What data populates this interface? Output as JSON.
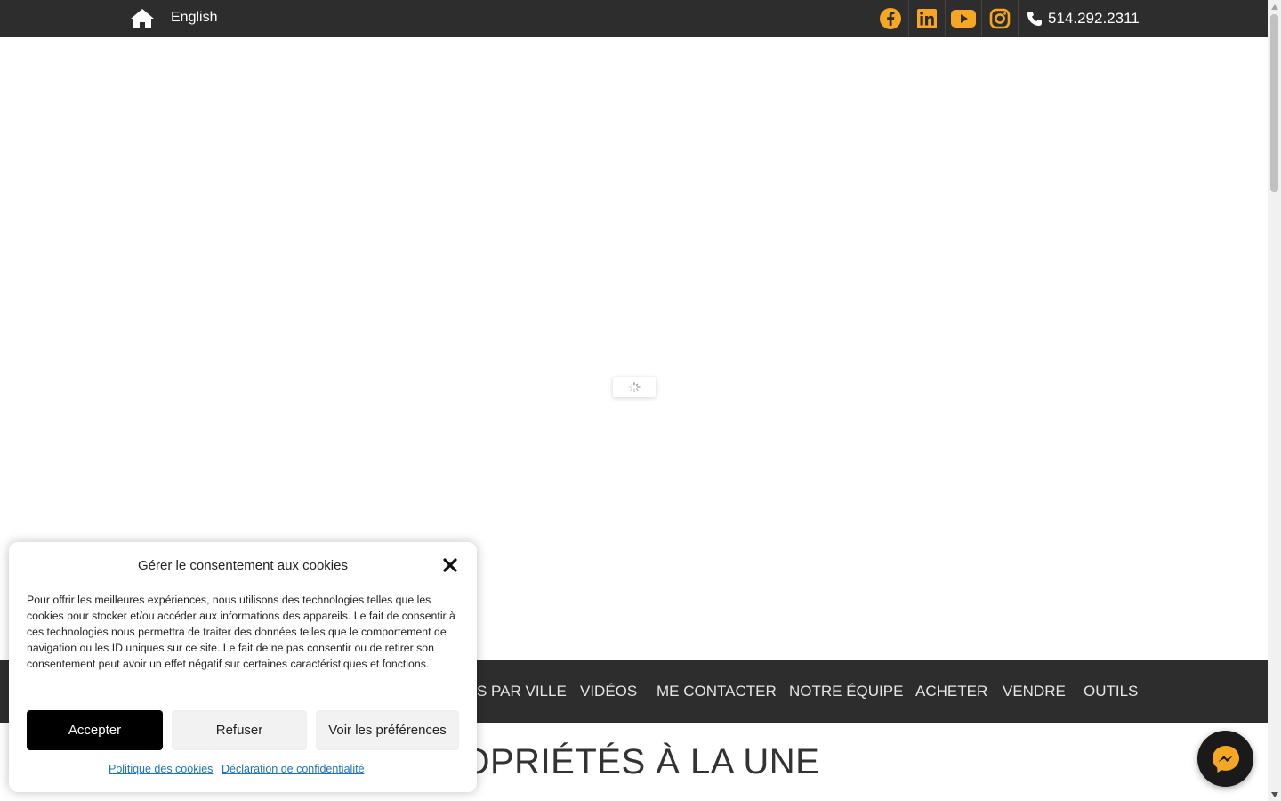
{
  "topbar": {
    "home_icon": "home-icon",
    "lang_label": "English",
    "social": [
      {
        "name": "facebook",
        "icon": "facebook-icon"
      },
      {
        "name": "linkedin",
        "icon": "linkedin-icon"
      },
      {
        "name": "youtube",
        "icon": "youtube-icon"
      },
      {
        "name": "instagram",
        "icon": "instagram-icon"
      }
    ],
    "phone_icon": "phone-icon",
    "phone": "514.292.2311",
    "icon_color": "#f5a623",
    "bg_color": "#2d2d2d"
  },
  "hero": {
    "loading_icon": "spinner-icon"
  },
  "nav": {
    "items": [
      "S PAR VILLE",
      "VIDÉOS",
      "ME CONTACTER",
      "NOTRE ÉQUIPE",
      "ACHETER",
      "VENDRE",
      "OUTILS"
    ]
  },
  "section": {
    "title": "ROPRIÉTÉS À LA UNE"
  },
  "cookie": {
    "title": "Gérer le consentement aux cookies",
    "close_icon": "close-icon",
    "body": "Pour offrir les meilleures expériences, nous utilisons des technologies telles que les cookies pour stocker et/ou accéder aux informations des appareils. Le fait de consentir à ces technologies nous permettra de traiter des données telles que le comportement de navigation ou les ID uniques sur ce site. Le fait de ne pas consentir ou de retirer son consentement peut avoir un effet négatif sur certaines caractéristiques et fonctions.",
    "accept_label": "Accepter",
    "refuse_label": "Refuser",
    "prefs_label": "Voir les préférences",
    "policy_link": "Politique des cookies",
    "privacy_link": "Déclaration de confidentialité"
  },
  "messenger": {
    "icon": "messenger-icon"
  }
}
